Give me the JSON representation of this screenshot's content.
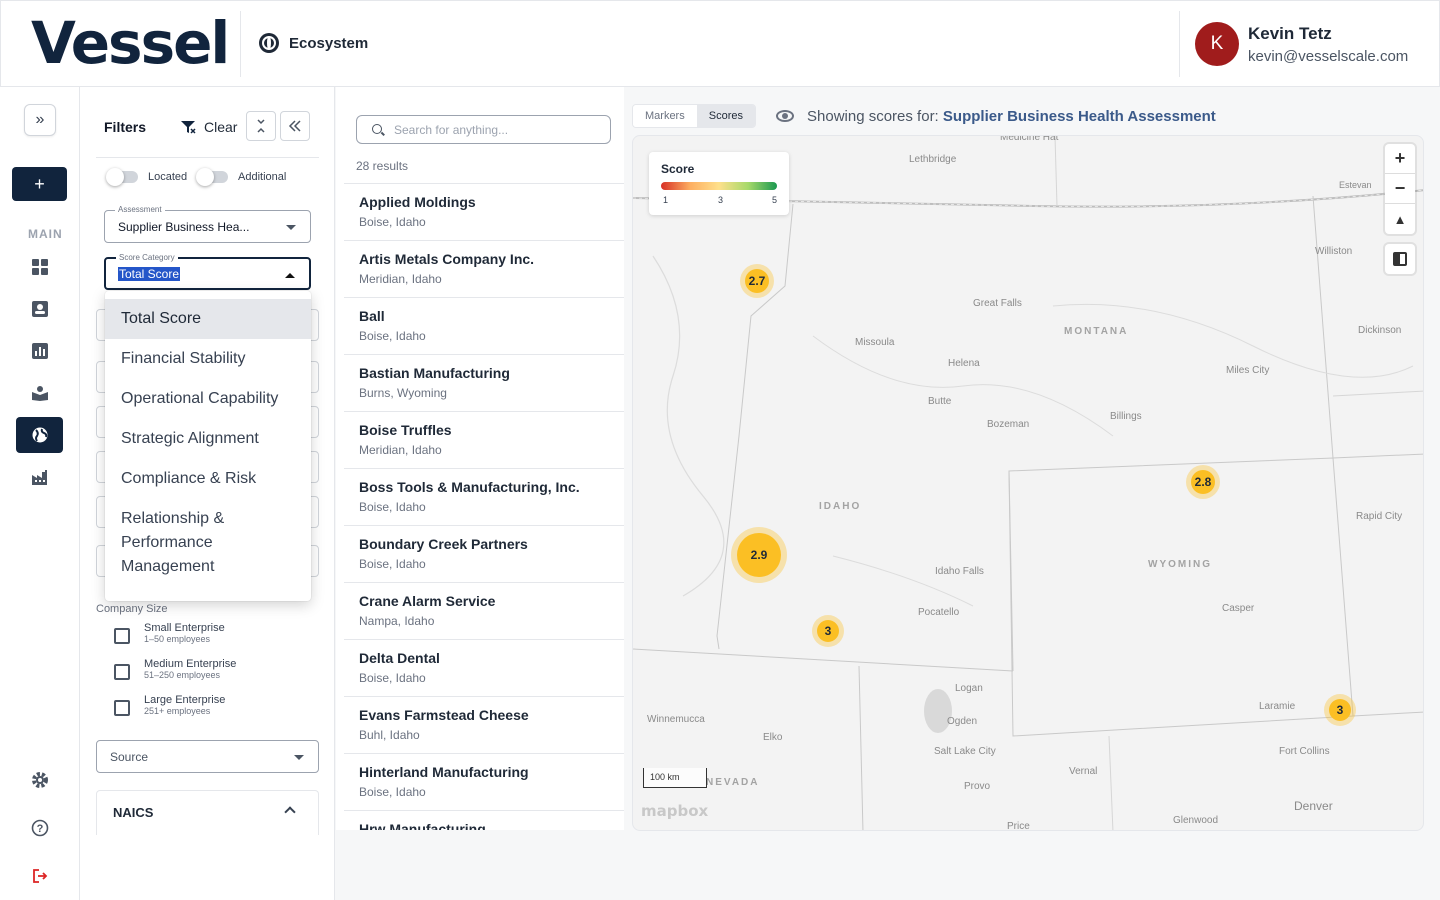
{
  "header": {
    "logo": "Vessel",
    "section": "Ecosystem",
    "user": {
      "initial": "K",
      "name": "Kevin Tetz",
      "email": "kevin@vesselscale.com"
    }
  },
  "rail": {
    "expand_icon": "»",
    "add_label": "+",
    "main_label": "MAIN",
    "items": [
      {
        "icon": "dashboard-icon"
      },
      {
        "icon": "contacts-icon"
      },
      {
        "icon": "analytics-icon"
      },
      {
        "icon": "learning-icon"
      },
      {
        "icon": "globe-icon",
        "active": true
      },
      {
        "icon": "factory-icon"
      },
      {
        "icon": "settings-icon"
      },
      {
        "icon": "help-icon"
      },
      {
        "icon": "logout-icon"
      }
    ]
  },
  "filters": {
    "title": "Filters",
    "clear_label": "Clear",
    "toggles": [
      "Located",
      "Additional"
    ],
    "assessment": {
      "label": "Assessment",
      "value": "Supplier Business Hea..."
    },
    "score_category": {
      "label": "Score Category",
      "value": "Total Score",
      "options": [
        "Total Score",
        "Financial Stability",
        "Operational Capability",
        "Strategic Alignment",
        "Compliance & Risk",
        "Relationship & Performance Management"
      ]
    },
    "company_size": {
      "label": "Company Size",
      "options": [
        {
          "title": "Small Enterprise",
          "sub": "1–50 employees"
        },
        {
          "title": "Medium Enterprise",
          "sub": "51–250 employees"
        },
        {
          "title": "Large Enterprise",
          "sub": "251+ employees"
        }
      ]
    },
    "source_label": "Source",
    "naics_label": "NAICS"
  },
  "results": {
    "search_placeholder": "Search for anything...",
    "count": "28 results",
    "items": [
      {
        "name": "Applied Moldings",
        "loc": "Boise, Idaho"
      },
      {
        "name": "Artis Metals Company Inc.",
        "loc": "Meridian, Idaho"
      },
      {
        "name": "Ball",
        "loc": "Boise, Idaho"
      },
      {
        "name": "Bastian Manufacturing",
        "loc": "Burns, Wyoming"
      },
      {
        "name": "Boise Truffles",
        "loc": "Meridian, Idaho"
      },
      {
        "name": "Boss Tools & Manufacturing, Inc.",
        "loc": "Boise, Idaho"
      },
      {
        "name": "Boundary Creek Partners",
        "loc": "Boise, Idaho"
      },
      {
        "name": "Crane Alarm Service",
        "loc": "Nampa, Idaho"
      },
      {
        "name": "Delta Dental",
        "loc": "Boise, Idaho"
      },
      {
        "name": "Evans Farmstead Cheese",
        "loc": "Buhl, Idaho"
      },
      {
        "name": "Hinterland Manufacturing",
        "loc": "Boise, Idaho"
      },
      {
        "name": "Hrw Manufacturing",
        "loc": ""
      }
    ]
  },
  "map": {
    "tabs": [
      "Markers",
      "Scores"
    ],
    "active_tab": "Scores",
    "showing_prefix": "Showing scores for:",
    "showing_value": "Supplier Business Health Assessment",
    "legend": {
      "title": "Score",
      "ticks": [
        "1",
        "3",
        "5"
      ]
    },
    "zoom_in": "+",
    "zoom_out": "−",
    "compass": "▲",
    "scale_label": "100 km",
    "attribution": "mapbox",
    "markers": [
      "2.7",
      "2.8",
      "2.9",
      "3",
      "3"
    ],
    "states": [
      "MONTANA",
      "IDAHO",
      "WYOMING",
      "NEVADA"
    ],
    "cities": [
      "Medicine Hat",
      "Lethbridge",
      "Estevan",
      "Williston",
      "Great Falls",
      "Missoula",
      "Helena",
      "Butte",
      "Bozeman",
      "Billings",
      "Miles City",
      "Dickinson",
      "Rapid City",
      "Idaho Falls",
      "Pocatello",
      "Casper",
      "Logan",
      "Ogden",
      "Salt Lake City",
      "Provo",
      "Vernal",
      "Laramie",
      "Fort Collins",
      "Denver",
      "Winnemucca",
      "Elko",
      "Glenwood",
      "Price"
    ]
  }
}
